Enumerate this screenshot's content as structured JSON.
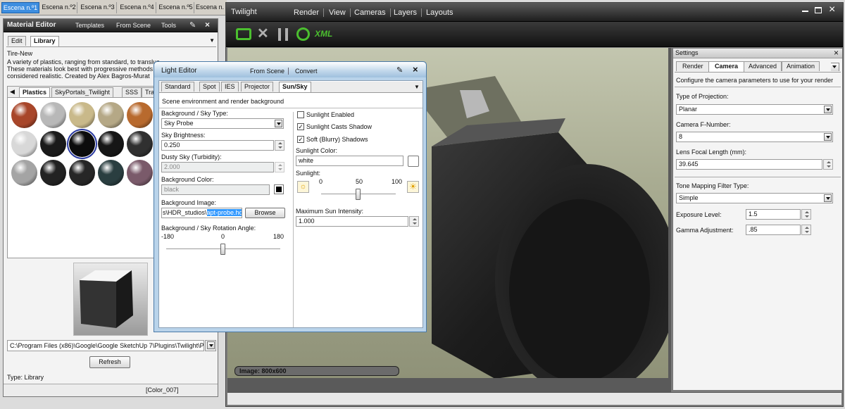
{
  "scene_tabs": [
    "Escena n.º1",
    "Escena n.º2",
    "Escena n.º3",
    "Escena n.º4",
    "Escena n.º5",
    "Escena n."
  ],
  "material_editor": {
    "title": "Material Editor",
    "menu": [
      "Templates",
      "From Scene",
      "Tools"
    ],
    "tabs": [
      "Edit",
      "Library"
    ],
    "material_name": "Tire-New",
    "description": "A variety of plastics, ranging from standard, to transluc\nThese materials look best with progressive methods, bu\nconsidered realistic. Created by Alex Bagros-Murat",
    "lib_tabs": [
      "Plastics",
      "SkyPortals_Twilight",
      "SSS",
      "Tra"
    ],
    "path": "C:\\Program Files (x86)\\Google\\Google SketchUp 7\\Plugins\\Twilight\\Previe",
    "refresh": "Refresh",
    "type": "Type: Library",
    "color_status": "[Color_007]",
    "swatch_colors": [
      "#a8462a",
      "#b8b8b8",
      "#c9b98a",
      "#b5a886",
      "#b86a2e",
      "#d8d8d8",
      "#1a1a1a",
      "#0c0c0c",
      "#161616",
      "#303030",
      "#a4a4a4",
      "#222222",
      "#262626",
      "#2a3e40",
      "#7a5a6a"
    ]
  },
  "twilight": {
    "title": "Twilight",
    "menu": [
      "Render",
      "View",
      "Cameras",
      "Layers",
      "Layouts"
    ],
    "toolbar_xml": "XML",
    "image_status": "Image: 800x600"
  },
  "light_editor": {
    "title": "Light Editor",
    "menu": [
      "From Scene",
      "Convert"
    ],
    "tabs": [
      "Standard",
      "Spot",
      "IES",
      "Projector",
      "Sun/Sky"
    ],
    "description": "Scene environment and render background",
    "bg_type_label": "Background / Sky Type:",
    "bg_type_value": "Sky Probe",
    "brightness_label": "Sky Brightness:",
    "brightness_value": "0.250",
    "turbidity_label": "Dusty Sky (Turbidity):",
    "turbidity_value": "2.000",
    "bg_color_label": "Background Color:",
    "bg_color_value": "black",
    "bg_image_label": "Background Image:",
    "bg_image_prefix": "s\\HDR_studios\\",
    "bg_image_selected": "apt-probe.hdr",
    "browse": "Browse",
    "rotation_label": "Background / Sky Rotation Angle:",
    "rotation_ticks": [
      "-180",
      "0",
      "180"
    ],
    "rotation_value": 0,
    "sunlight_enabled": "Sunlight Enabled",
    "casts_shadow": "Sunlight Casts Shadow",
    "soft_shadows": "Soft (Blurry) Shadows",
    "sun_color_label": "Sunlight Color:",
    "sun_color_value": "white",
    "sunlight_label": "Sunlight:",
    "sun_ticks": [
      "0",
      "50",
      "100"
    ],
    "sunlight_value": 50,
    "max_intensity_label": "Maximum Sun Intensity:",
    "max_intensity_value": "1.000"
  },
  "settings": {
    "title": "Settings",
    "tabs": [
      "Render",
      "Camera",
      "Advanced",
      "Animation"
    ],
    "description": "Configure the camera parameters to use for your render",
    "projection_label": "Type of Projection:",
    "projection_value": "Planar",
    "fnumber_label": "Camera F-Number:",
    "fnumber_value": "8",
    "focal_label": "Lens Focal Length (mm):",
    "focal_value": "39.645",
    "tonemap_label": "Tone Mapping Filter Type:",
    "tonemap_value": "Simple",
    "exposure_label": "Exposure Level:",
    "exposure_value": "1.5",
    "gamma_label": "Gamma Adjustment:",
    "gamma_value": ".85"
  }
}
